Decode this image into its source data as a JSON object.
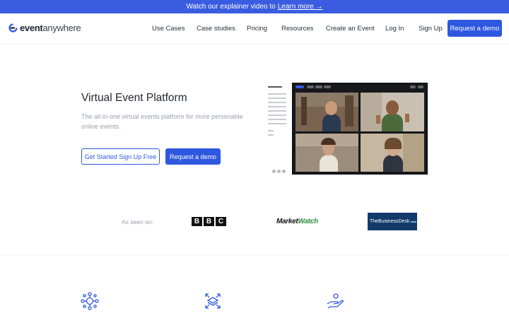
{
  "banner": {
    "text": "Watch our explainer video to",
    "link": "Learn more →"
  },
  "logo": {
    "bold": "event",
    "light": "anywhere"
  },
  "nav": {
    "items": [
      "Use Cases",
      "Case studies",
      "Pricing",
      "Resources",
      "Create an Event",
      "Log In",
      "Sign Up"
    ],
    "demo_label": "Request a demo"
  },
  "hero": {
    "title": "Virtual Event Platform",
    "subtitle": "The all-in-one virtual events platform for more personable online events.",
    "primary_cta": "Get Started Sign Up Free",
    "secondary_cta": "Request a demo"
  },
  "seen_on": {
    "label": "As seen on:",
    "bbc": [
      "B",
      "B",
      "C"
    ],
    "marketwatch": {
      "a": "Market",
      "b": "Watch"
    },
    "businessdesk": "TheBusinessDesk"
  },
  "colors": {
    "accent": "#2f58e0",
    "banner": "#3a5ce0"
  }
}
